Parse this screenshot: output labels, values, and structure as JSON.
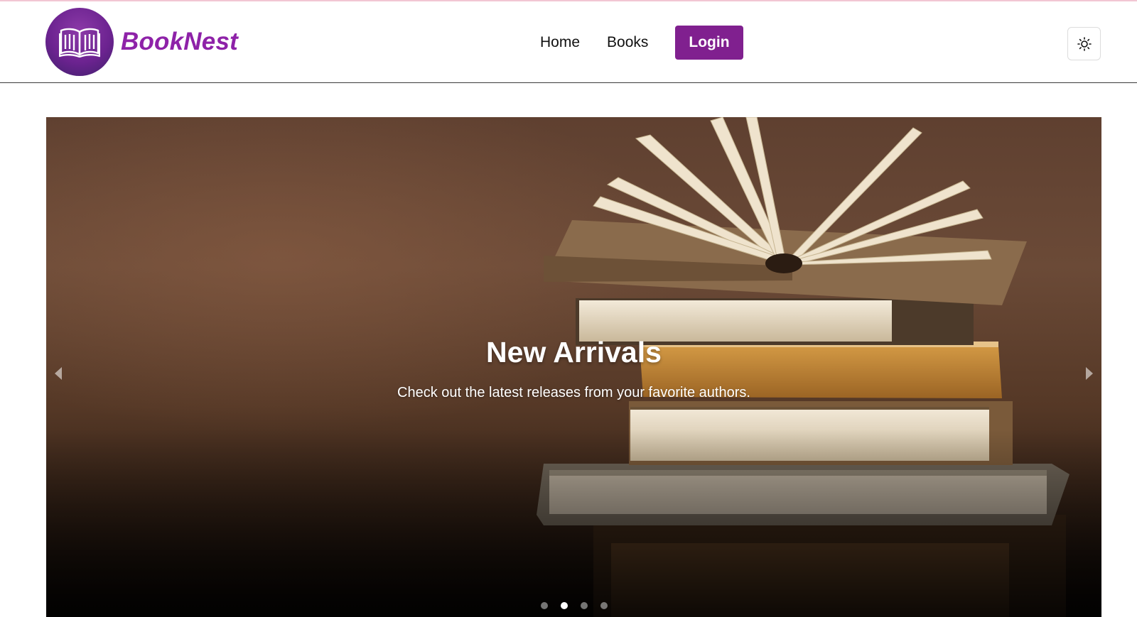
{
  "brand": {
    "name": "BookNest",
    "logo_icon": "open-book-icon",
    "color": "#8e22a8"
  },
  "nav": {
    "links": [
      {
        "label": "Home"
      },
      {
        "label": "Books"
      }
    ],
    "login_label": "Login",
    "login_color": "#80208f",
    "theme_toggle_icon": "sun-icon"
  },
  "carousel": {
    "slide": {
      "title": "New Arrivals",
      "text": "Check out the latest releases from your favorite authors."
    },
    "prev_icon": "chevron-left-icon",
    "next_icon": "chevron-right-icon",
    "slide_count": 4,
    "active_index": 1
  }
}
